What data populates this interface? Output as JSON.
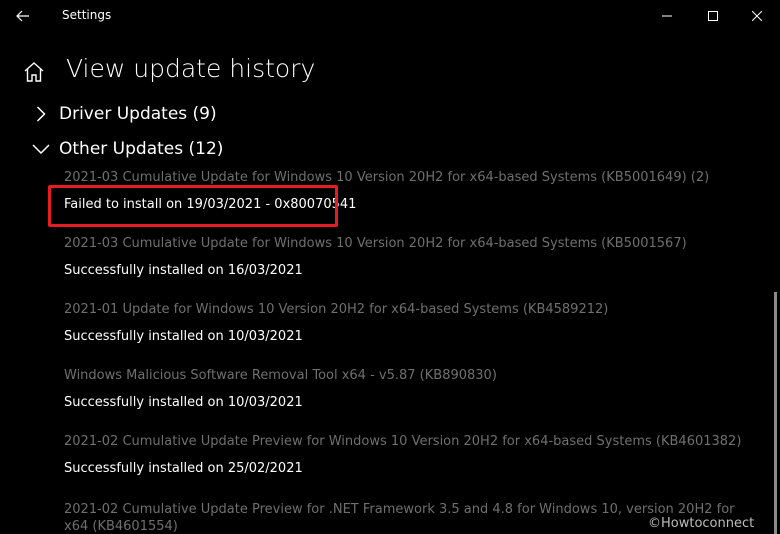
{
  "window": {
    "title": "Settings"
  },
  "header": {
    "title": "View update history"
  },
  "sections": {
    "driver": {
      "label": "Driver Updates (9)"
    },
    "other": {
      "label": "Other Updates (12)"
    }
  },
  "updates": [
    {
      "name": "2021-03 Cumulative Update for Windows 10 Version 20H2 for x64-based Systems (KB5001649) (2)",
      "status": "Failed to install on 19/03/2021 - 0x80070541"
    },
    {
      "name": "2021-03 Cumulative Update for Windows 10 Version 20H2 for x64-based Systems (KB5001567)",
      "status": "Successfully installed on 16/03/2021"
    },
    {
      "name": "2021-01 Update for Windows 10 Version 20H2 for x64-based Systems (KB4589212)",
      "status": "Successfully installed on 10/03/2021"
    },
    {
      "name": "Windows Malicious Software Removal Tool x64 - v5.87 (KB890830)",
      "status": "Successfully installed on 10/03/2021"
    },
    {
      "name": "2021-02 Cumulative Update Preview for Windows 10 Version 20H2 for x64-based Systems (KB4601382)",
      "status": "Successfully installed on 25/02/2021"
    },
    {
      "name": "2021-02 Cumulative Update Preview for .NET Framework 3.5 and 4.8 for Windows 10, version 20H2 for x64 (KB4601554)",
      "status": ""
    }
  ],
  "watermark": "©Howtoconnect",
  "colors": {
    "background": "#000000",
    "highlight_border": "#e51c23",
    "muted_text": "#6f6f6f"
  }
}
